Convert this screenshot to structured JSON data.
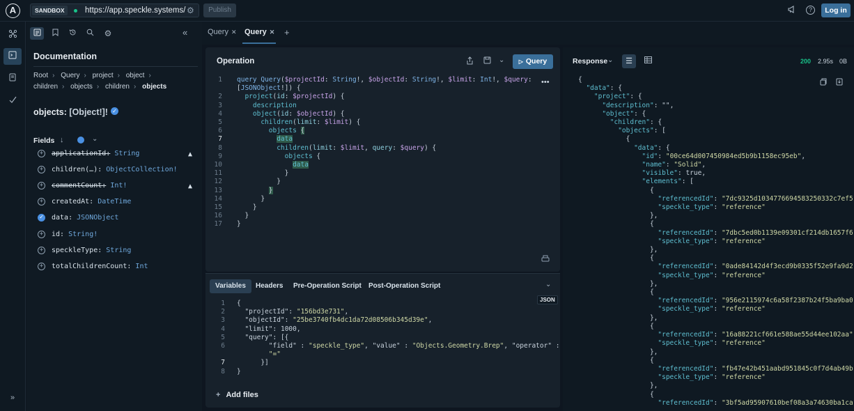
{
  "topbar": {
    "logo": "A",
    "sandbox_label": "SANDBOX",
    "url": "https://app.speckle.systems/",
    "publish_label": "Publish",
    "login_label": "Log in",
    "help_glyph": "?"
  },
  "rail": {
    "icons": [
      "graph-icon",
      "editor-icon",
      "document-icon",
      "check-icon"
    ],
    "expand_icon": "double-chevron-right-icon"
  },
  "docs": {
    "title": "Documentation",
    "breadcrumb": [
      "Root",
      "Query",
      "project",
      "object",
      "children",
      "objects",
      "children",
      "objects"
    ],
    "type_name": "objects:",
    "type_sig": "[Object!]!",
    "fields_label": "Fields",
    "fields": [
      {
        "name": "applicationId:",
        "type": "String",
        "deprecated": true,
        "selected": false
      },
      {
        "name": "children(…):",
        "type": "ObjectCollection!",
        "deprecated": false,
        "selected": false
      },
      {
        "name": "commentCount:",
        "type": "Int!",
        "deprecated": true,
        "selected": false
      },
      {
        "name": "createdAt:",
        "type": "DateTime",
        "deprecated": false,
        "selected": false
      },
      {
        "name": "data:",
        "type": "JSONObject",
        "deprecated": false,
        "selected": true
      },
      {
        "name": "id:",
        "type": "String!",
        "deprecated": false,
        "selected": false
      },
      {
        "name": "speckleType:",
        "type": "String",
        "deprecated": false,
        "selected": false
      },
      {
        "name": "totalChildrenCount:",
        "type": "Int",
        "deprecated": false,
        "selected": false
      }
    ]
  },
  "tabs": [
    {
      "label": "Query",
      "active": false
    },
    {
      "label": "Query",
      "active": true
    }
  ],
  "operation": {
    "title": "Operation",
    "run_label": "Query"
  },
  "variables": {
    "tabs": [
      "Variables",
      "Headers",
      "Pre-Operation Script",
      "Post-Operation Script"
    ],
    "badge": "JSON",
    "add_files_label": "Add files",
    "projectId": "\"156bd3e731\"",
    "objectId": "\"25be3740fb4dc1da72d08506b345d39e\"",
    "limit": "1000",
    "field_value": "\"speckle_type\"",
    "value_value": "\"Objects.Geometry.Brep\"",
    "operator_value": "\"=\""
  },
  "response": {
    "title": "Response",
    "status": "200",
    "time": "2.95s",
    "size": "0B",
    "object_id": "\"00ce64d007450984ed5b9b1158ec95eb\"",
    "object_name": "\"Solid\"",
    "elements": [
      "\"7dc9325d1034776694583250332c7ef5\"",
      "\"7dbc5ed0b1139e09301cf214db1657f6\"",
      "\"0ade84142d4f3ecd9b0335f52e9fa9d2\"",
      "\"956e2115974c6a58f2387b24f5ba9ba0\"",
      "\"16a88221cf661e588ae55d44ee102aa\"",
      "\"fb47e42b451aabd951845c0f7d4ab49b\"",
      "\"3bf5ad95907610bef08a3a74630ba1ca\""
    ],
    "speckle_type": "\"reference\""
  },
  "colors": {
    "accent": "#3a6f9a",
    "status_ok": "#19c38a",
    "selection": "#4a90e2"
  }
}
